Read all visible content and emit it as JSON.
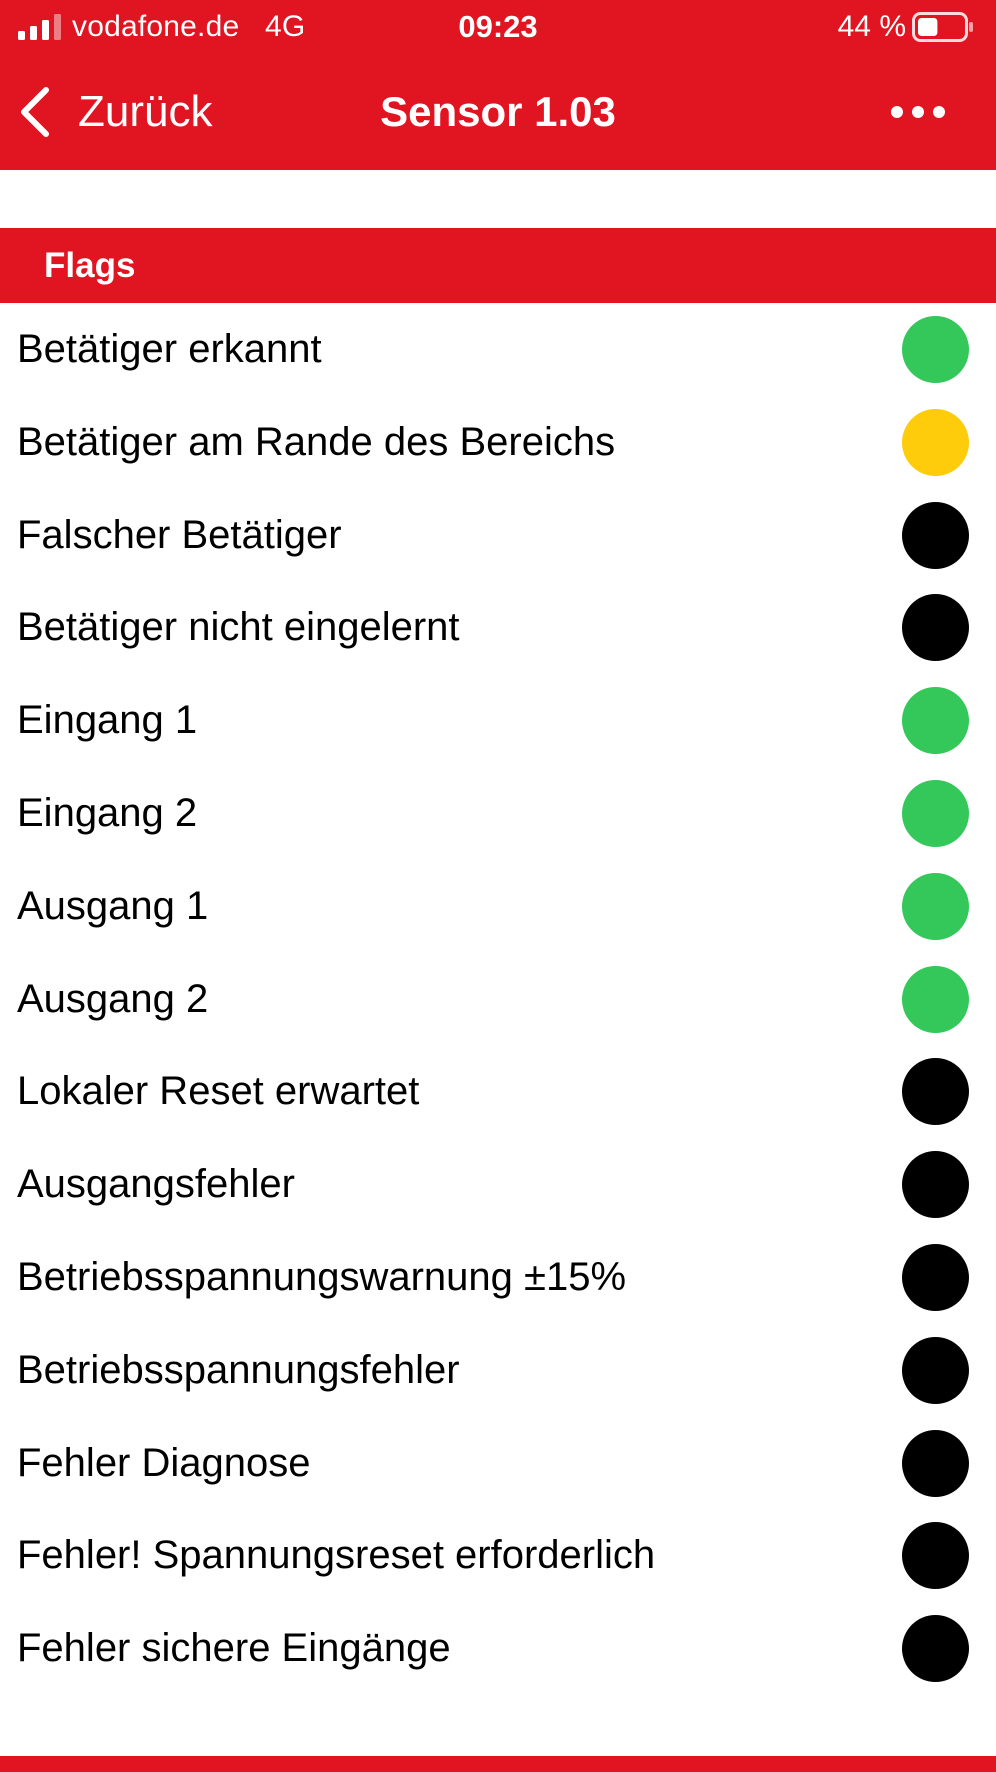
{
  "status_bar": {
    "carrier": "vodafone.de",
    "network": "4G",
    "time": "09:23",
    "battery_percent": "44 %",
    "battery_level": 0.44,
    "signal_bars": 3
  },
  "nav": {
    "back_label": "Zurück",
    "title": "Sensor 1.03"
  },
  "section": {
    "title": "Flags"
  },
  "colors": {
    "brand_red": "#e11421",
    "status_green": "#34c759",
    "status_yellow": "#fecc0b",
    "status_off": "#000000"
  },
  "flags": [
    {
      "label": "Betätiger erkannt",
      "status": "green"
    },
    {
      "label": "Betätiger am Rande des Bereichs",
      "status": "yellow"
    },
    {
      "label": "Falscher Betätiger",
      "status": "off"
    },
    {
      "label": "Betätiger nicht eingelernt",
      "status": "off"
    },
    {
      "label": "Eingang 1",
      "status": "green"
    },
    {
      "label": "Eingang 2",
      "status": "green"
    },
    {
      "label": "Ausgang 1",
      "status": "green"
    },
    {
      "label": "Ausgang 2",
      "status": "green"
    },
    {
      "label": "Lokaler Reset erwartet",
      "status": "off"
    },
    {
      "label": "Ausgangsfehler",
      "status": "off"
    },
    {
      "label": "Betriebsspannungswarnung ±15%",
      "status": "off"
    },
    {
      "label": "Betriebsspannungsfehler",
      "status": "off"
    },
    {
      "label": "Fehler Diagnose",
      "status": "off"
    },
    {
      "label": "Fehler! Spannungsreset erforderlich",
      "status": "off"
    },
    {
      "label": "Fehler sichere Eingänge",
      "status": "off"
    }
  ]
}
